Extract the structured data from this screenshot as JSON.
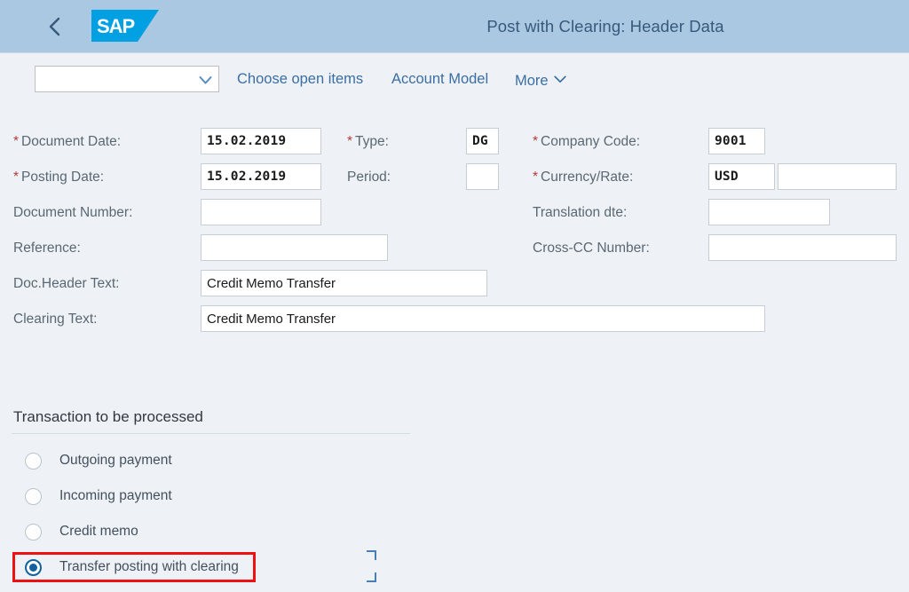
{
  "shell": {
    "title": "Post with Clearing: Header Data",
    "back_icon": "chevron-left-icon",
    "logo_text": "SAP"
  },
  "toolbar": {
    "select_value": "",
    "select_placeholder": "",
    "chevron_icon": "chevron-down-icon",
    "choose_open_items_label": "Choose open items",
    "account_model_label": "Account Model",
    "more_label": "More"
  },
  "form": {
    "left": [
      {
        "label": "Document Date:",
        "required": true,
        "value": "15.02.2019",
        "mono": true
      },
      {
        "label": "Posting Date:",
        "required": true,
        "value": "15.02.2019",
        "mono": true
      },
      {
        "label": "Document Number:",
        "required": false,
        "value": "",
        "mono": true
      },
      {
        "label": "Reference:",
        "required": false,
        "value": "",
        "mono": false
      },
      {
        "label": "Doc.Header Text:",
        "required": false,
        "value": "Credit Memo Transfer",
        "mono": false
      },
      {
        "label": "Clearing Text:",
        "required": false,
        "value": "Credit Memo Transfer",
        "mono": false
      }
    ],
    "middle": [
      {
        "label": "Type:",
        "required": true,
        "value": "DG",
        "mono": true
      },
      {
        "label": "Period:",
        "required": false,
        "value": "",
        "mono": true
      }
    ],
    "right": [
      {
        "label": "Company Code:",
        "required": true,
        "value": "9001",
        "mono": true
      },
      {
        "label": "Currency/Rate:",
        "required": true,
        "value": "USD",
        "mono": true,
        "rate_value": ""
      },
      {
        "label": "Translation dte:",
        "required": false,
        "value": "",
        "mono": true
      },
      {
        "label": "Cross-CC Number:",
        "required": false,
        "value": "",
        "mono": true
      }
    ],
    "required_marker": "*"
  },
  "section": {
    "title": "Transaction to be processed",
    "options": [
      {
        "label": "Outgoing payment",
        "selected": false
      },
      {
        "label": "Incoming payment",
        "selected": false
      },
      {
        "label": "Credit memo",
        "selected": false
      },
      {
        "label": "Transfer posting with clearing",
        "selected": true
      }
    ]
  },
  "colors": {
    "shell_header": "#abc8e2",
    "page_background": "#eef2f6",
    "link": "#3a6ea5",
    "title_text": "#36597c",
    "required_asterisk": "#b33a3a",
    "highlight_border": "#ee1111",
    "radio_selected": "#11629e",
    "sap_logo_blue": "#00a0e3",
    "selection_frame": "#4a7fb5"
  }
}
